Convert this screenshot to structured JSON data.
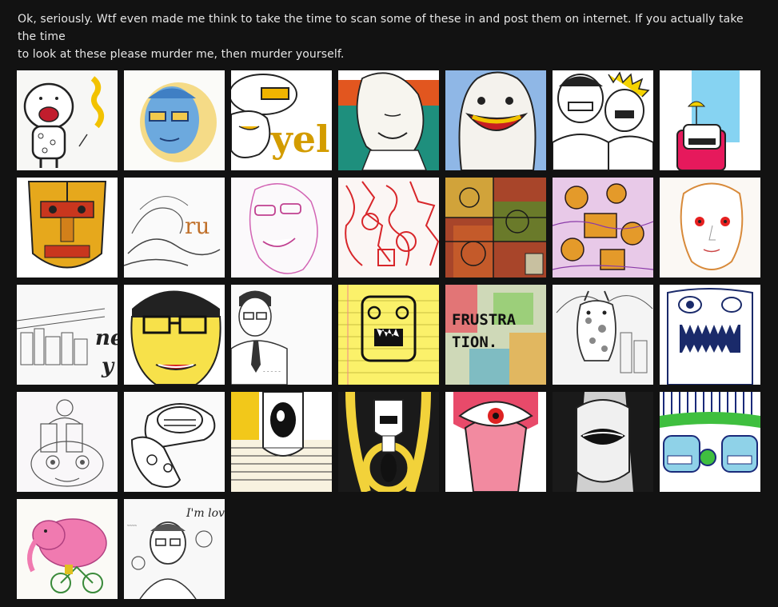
{
  "intro": {
    "line1": "Ok, seriously.  Wtf even made me think to take the time to scan some of these in and post them on internet. If you actually take the time",
    "line2": "to look at these please murder me, then murder yourself."
  },
  "thumbnails": [
    {
      "index": 1,
      "subject": "cartoon-monster-with-balloon",
      "text": ""
    },
    {
      "index": 2,
      "subject": "blue-face-with-yellow-glasses",
      "text": ""
    },
    {
      "index": 3,
      "subject": "yell-lettering-face",
      "text": "yel"
    },
    {
      "index": 4,
      "subject": "smiling-face-green-orange-stripes",
      "text": ""
    },
    {
      "index": 5,
      "subject": "grinning-creature-on-blue",
      "text": ""
    },
    {
      "index": 6,
      "subject": "two-punk-characters",
      "text": ""
    },
    {
      "index": 7,
      "subject": "pink-robot-with-umbrella",
      "text": ""
    },
    {
      "index": 8,
      "subject": "golden-tiki-mask",
      "text": ""
    },
    {
      "index": 9,
      "subject": "sketch-with-letters",
      "text": "ru"
    },
    {
      "index": 10,
      "subject": "pink-ink-face-with-glasses",
      "text": ""
    },
    {
      "index": 11,
      "subject": "red-doodle-pattern",
      "text": ""
    },
    {
      "index": 12,
      "subject": "colored-machinery-doodle",
      "text": ""
    },
    {
      "index": 13,
      "subject": "orange-purple-doodle",
      "text": ""
    },
    {
      "index": 14,
      "subject": "woman-face-red-eyes",
      "text": ""
    },
    {
      "index": 15,
      "subject": "city-sketch-with-letters",
      "text": "ne y"
    },
    {
      "index": 16,
      "subject": "yellow-man-with-glasses",
      "text": ""
    },
    {
      "index": 17,
      "subject": "man-in-tie-sketch",
      "text": ""
    },
    {
      "index": 18,
      "subject": "robot-on-yellow-paper",
      "text": ""
    },
    {
      "index": 19,
      "subject": "frustration-lettering",
      "text": "FRUSTRA TION."
    },
    {
      "index": 20,
      "subject": "giraffe-sketch",
      "text": ""
    },
    {
      "index": 21,
      "subject": "blue-monster-mouth",
      "text": ""
    },
    {
      "index": 22,
      "subject": "face-with-couple-sketch",
      "text": ""
    },
    {
      "index": 23,
      "subject": "mechanical-hand-sketch",
      "text": ""
    },
    {
      "index": 24,
      "subject": "yellow-black-eye-figure",
      "text": ""
    },
    {
      "index": 25,
      "subject": "black-yellow-skull-figure",
      "text": ""
    },
    {
      "index": 26,
      "subject": "red-eye-tongue",
      "text": ""
    },
    {
      "index": 27,
      "subject": "black-face-mouth",
      "text": ""
    },
    {
      "index": 28,
      "subject": "green-blue-characters",
      "text": ""
    },
    {
      "index": 29,
      "subject": "pink-elephant-on-bike",
      "text": ""
    },
    {
      "index": 30,
      "subject": "im-lovin-sketch",
      "text": "I'm lovin'"
    }
  ]
}
